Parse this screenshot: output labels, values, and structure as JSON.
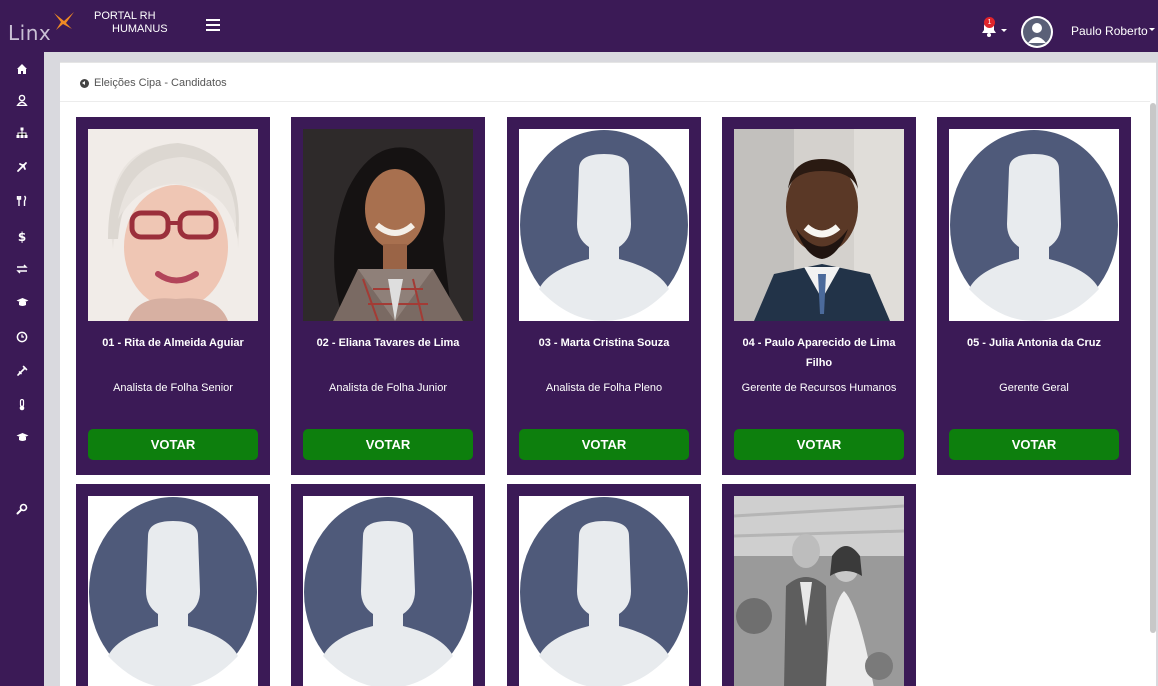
{
  "app": {
    "logo_text": "Linx",
    "portal_title_line1": "PORTAL RH",
    "portal_title_line2": "HUMANUS",
    "notification_count": "1",
    "user_name": "Paulo Roberto"
  },
  "colors": {
    "brand_purple": "#3b1a56",
    "vote_green": "#0d7f0d",
    "badge_red": "#e0242b",
    "placeholder_bg": "#4f5a7a",
    "placeholder_fg": "#e8ebee"
  },
  "sidebar": {
    "icons": [
      "home-icon",
      "user-icon",
      "sitemap-icon",
      "plane-icon",
      "cutlery-icon",
      "dollar-icon",
      "exchange-icon",
      "graduation-cap-icon",
      "clock-icon",
      "syringe-icon",
      "thermometer-icon",
      "graduation-cap-icon",
      "wrench-icon"
    ]
  },
  "breadcrumb": {
    "text": "Eleições Cipa - Candidatos"
  },
  "candidates": [
    {
      "name": "01 - Rita de Almeida Aguiar",
      "role": "Analista de Folha Senior",
      "vote_label": "VOTAR",
      "photo": "photo-woman-glasses"
    },
    {
      "name": "02 - Eliana Tavares de Lima",
      "role": "Analista de Folha Junior",
      "vote_label": "VOTAR",
      "photo": "photo-woman-dark-hair"
    },
    {
      "name": "03 - Marta Cristina Souza",
      "role": "Analista de Folha Pleno",
      "vote_label": "VOTAR",
      "photo": "avatar-placeholder"
    },
    {
      "name": "04 - Paulo Aparecido de Lima Filho",
      "role": "Gerente de Recursos Humanos",
      "vote_label": "VOTAR",
      "photo": "photo-man-smiling"
    },
    {
      "name": "05 - Julia Antonia da Cruz",
      "role": "Gerente Geral",
      "vote_label": "VOTAR",
      "photo": "avatar-placeholder"
    },
    {
      "name": "",
      "role": "",
      "vote_label": "",
      "photo": "avatar-placeholder"
    },
    {
      "name": "",
      "role": "",
      "vote_label": "",
      "photo": "avatar-placeholder"
    },
    {
      "name": "",
      "role": "",
      "vote_label": "",
      "photo": "avatar-placeholder"
    },
    {
      "name": "",
      "role": "",
      "vote_label": "",
      "photo": "photo-wedding-couple"
    }
  ]
}
